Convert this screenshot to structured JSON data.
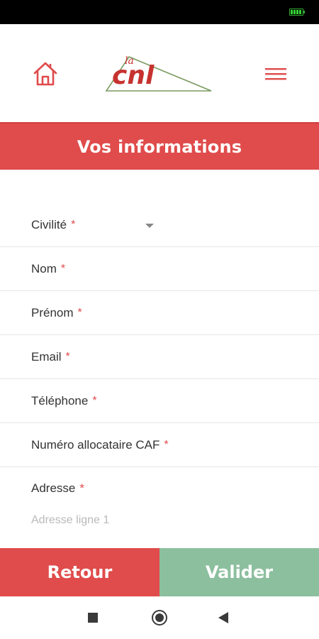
{
  "colors": {
    "primary": "#e04b4b",
    "validate": "#8cbf9e",
    "required": "#e04b4b",
    "logo_line": "#7a9a5e"
  },
  "header": {
    "home_icon": "home-icon",
    "menu_icon": "hamburger-menu-icon",
    "logo": {
      "prefix": "la",
      "text": "cnl"
    }
  },
  "page": {
    "title": "Vos informations"
  },
  "form": {
    "required_mark": "*",
    "fields": [
      {
        "label": "Civilité",
        "value": ""
      },
      {
        "label": "Nom",
        "value": ""
      },
      {
        "label": "Prénom",
        "value": ""
      },
      {
        "label": "Email",
        "value": ""
      },
      {
        "label": "Téléphone",
        "value": ""
      },
      {
        "label": "Numéro allocataire CAF",
        "value": ""
      }
    ],
    "address": {
      "label": "Adresse",
      "placeholder": "Adresse ligne 1",
      "value": ""
    }
  },
  "actions": {
    "back_label": "Retour",
    "validate_label": "Valider"
  },
  "system_nav": {
    "recent": "square-icon",
    "home": "circle-icon",
    "back": "triangle-back-icon"
  }
}
